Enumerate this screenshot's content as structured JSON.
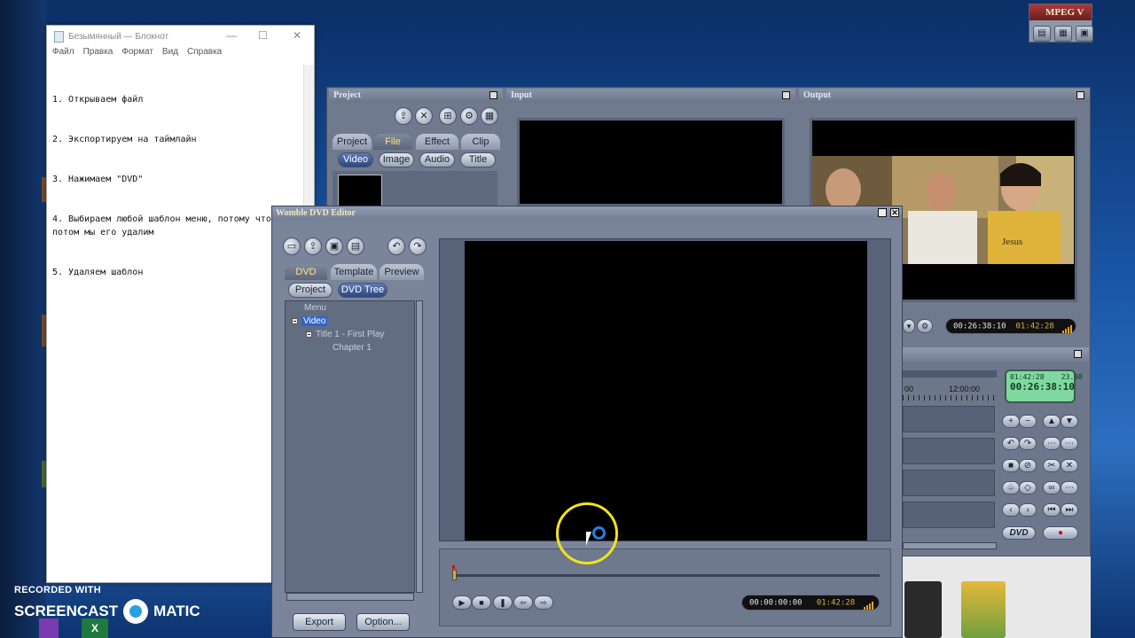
{
  "notepad": {
    "title": "Безымянный — Блокнот",
    "menu": [
      "Файл",
      "Правка",
      "Формат",
      "Вид",
      "Справка"
    ],
    "lines": [
      "1. Открываем файл",
      "2. Экспортируем на таймлайн",
      "3. Нажимаем \"DVD\"",
      "4. Выбираем любой шаблон меню, потому что потом мы его удалим",
      "5. Удаляем шаблон"
    ]
  },
  "mpeg_window": {
    "title": "MPEG V"
  },
  "panels": {
    "project": {
      "title": "Project",
      "tabs": [
        "Project",
        "File",
        "Effect",
        "Clip"
      ],
      "active_tab": "File",
      "subtabs": [
        "Video",
        "Image",
        "Audio",
        "Title"
      ],
      "active_subtab": "Video"
    },
    "input": {
      "title": "Input"
    },
    "output": {
      "title": "Output",
      "timecode_current": "00:26:38:10",
      "timecode_total": "01:42:28",
      "scene_text": "Jesus"
    }
  },
  "timeline": {
    "ruler_labels": [
      "00",
      "12:00:00"
    ],
    "lcd": {
      "top_left": "01:42:28",
      "top_right": "23.98",
      "main": "00:26:38:10"
    },
    "dvd_button": "DVD"
  },
  "dvd_editor": {
    "title": "Womble DVD Editor",
    "tabs": [
      "DVD",
      "Template",
      "Preview"
    ],
    "active_tab": "DVD",
    "subtabs": [
      "Project",
      "DVD Tree"
    ],
    "active_subtab": "DVD Tree",
    "tree": {
      "menu": "Menu",
      "video": "Video",
      "title": "Title 1  - First Play",
      "chapter": "Chapter 1"
    },
    "timecode_current": "00:00:00:00",
    "timecode_total": "01:42:28",
    "export_button": "Export",
    "option_button": "Option..."
  },
  "watermark": {
    "top": "RECORDED WITH",
    "left": "SCREENCAST",
    "right": "MATIC"
  },
  "colors": {
    "accent_tab": "#ffe082",
    "selection": "#2f66c7",
    "cursor_ring": "#f2e31c"
  }
}
